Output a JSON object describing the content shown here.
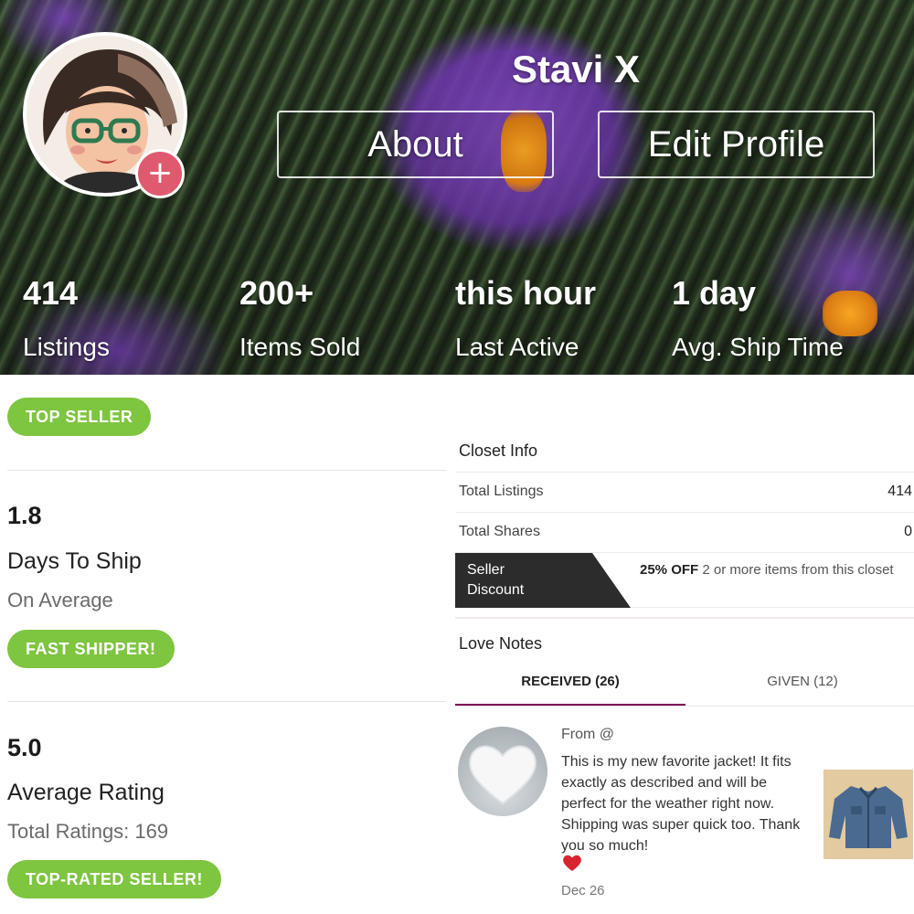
{
  "profile": {
    "username": "Stavi X",
    "about_label": "About",
    "edit_label": "Edit Profile",
    "add_icon": "+"
  },
  "stats": [
    {
      "value": "414",
      "label": "Listings"
    },
    {
      "value": "200+",
      "label": "Items Sold"
    },
    {
      "value": "this hour",
      "label": "Last Active"
    },
    {
      "value": "1 day",
      "label": "Avg. Ship Time"
    }
  ],
  "left": {
    "top_seller_badge": "TOP SELLER",
    "days_to_ship": {
      "value": "1.8",
      "title": "Days To Ship",
      "sub": "On Average",
      "badge": "FAST SHIPPER!"
    },
    "rating": {
      "value": "5.0",
      "title": "Average Rating",
      "sub": "Total Ratings: 169",
      "badge": "TOP-RATED SELLER!"
    }
  },
  "closet_info": {
    "title": "Closet Info",
    "rows": [
      {
        "key": "Total Listings",
        "value": "414"
      },
      {
        "key": "Total Shares",
        "value": "0"
      }
    ],
    "discount": {
      "tag": "Seller Discount",
      "tag_line1": "Seller",
      "tag_line2": "Discount",
      "highlight": "25% OFF",
      "text": " 2 or more items from this closet"
    }
  },
  "love_notes": {
    "title": "Love Notes",
    "tabs": [
      {
        "label": "RECEIVED (26)",
        "active": true
      },
      {
        "label": "GIVEN (12)",
        "active": false
      }
    ],
    "note": {
      "from": "From @",
      "body": "This is my new favorite jacket! It fits exactly as described and will be perfect for the weather right now. Shipping was super quick too. Thank you so much!",
      "date": "Dec 26"
    }
  },
  "colors": {
    "badge_green": "#7ec540",
    "accent": "#7f0353",
    "add_button": "#e05a6f",
    "heart": "#d9232e"
  },
  "icons": [
    "plus-icon",
    "white-heart-icon",
    "red-heart-icon",
    "denim-jacket-thumbnail"
  ]
}
